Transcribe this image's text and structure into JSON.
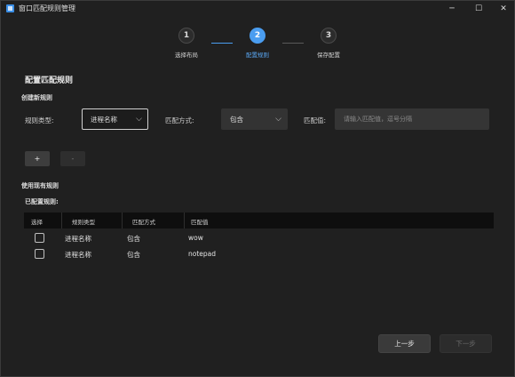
{
  "window": {
    "title": "窗口匹配规则管理",
    "minimize_glyph": "─",
    "maximize_glyph": "☐",
    "close_glyph": "✕"
  },
  "stepper": {
    "steps": [
      {
        "number": "1",
        "label": "选择布局",
        "state": "done"
      },
      {
        "number": "2",
        "label": "配置规则",
        "state": "active"
      },
      {
        "number": "3",
        "label": "保存配置",
        "state": "pending"
      }
    ]
  },
  "section": {
    "title": "配置匹配规则",
    "create_heading": "创建新规则",
    "existing_heading": "使用现有规则",
    "configured_heading": "已配置规则:"
  },
  "form": {
    "rule_type_label": "规则类型:",
    "rule_type_value": "进程名称",
    "match_mode_label": "匹配方式:",
    "match_mode_value": "包含",
    "match_value_label": "匹配值:",
    "match_value_placeholder": "请输入匹配值，逗号分隔",
    "match_value_value": "",
    "add_label": "+",
    "remove_label": "-",
    "chevron_glyph": "⌵"
  },
  "table": {
    "columns": [
      "选择",
      "规则类型",
      "匹配方式",
      "匹配值"
    ],
    "rows": [
      {
        "checked": false,
        "type": "进程名称",
        "mode": "包含",
        "value": "wow"
      },
      {
        "checked": false,
        "type": "进程名称",
        "mode": "包含",
        "value": "notepad"
      }
    ]
  },
  "footer": {
    "prev_label": "上一步",
    "next_label": "下一步"
  },
  "colors": {
    "accent": "#4a9df0",
    "background": "#202020",
    "table_header": "#0e0e0e"
  }
}
